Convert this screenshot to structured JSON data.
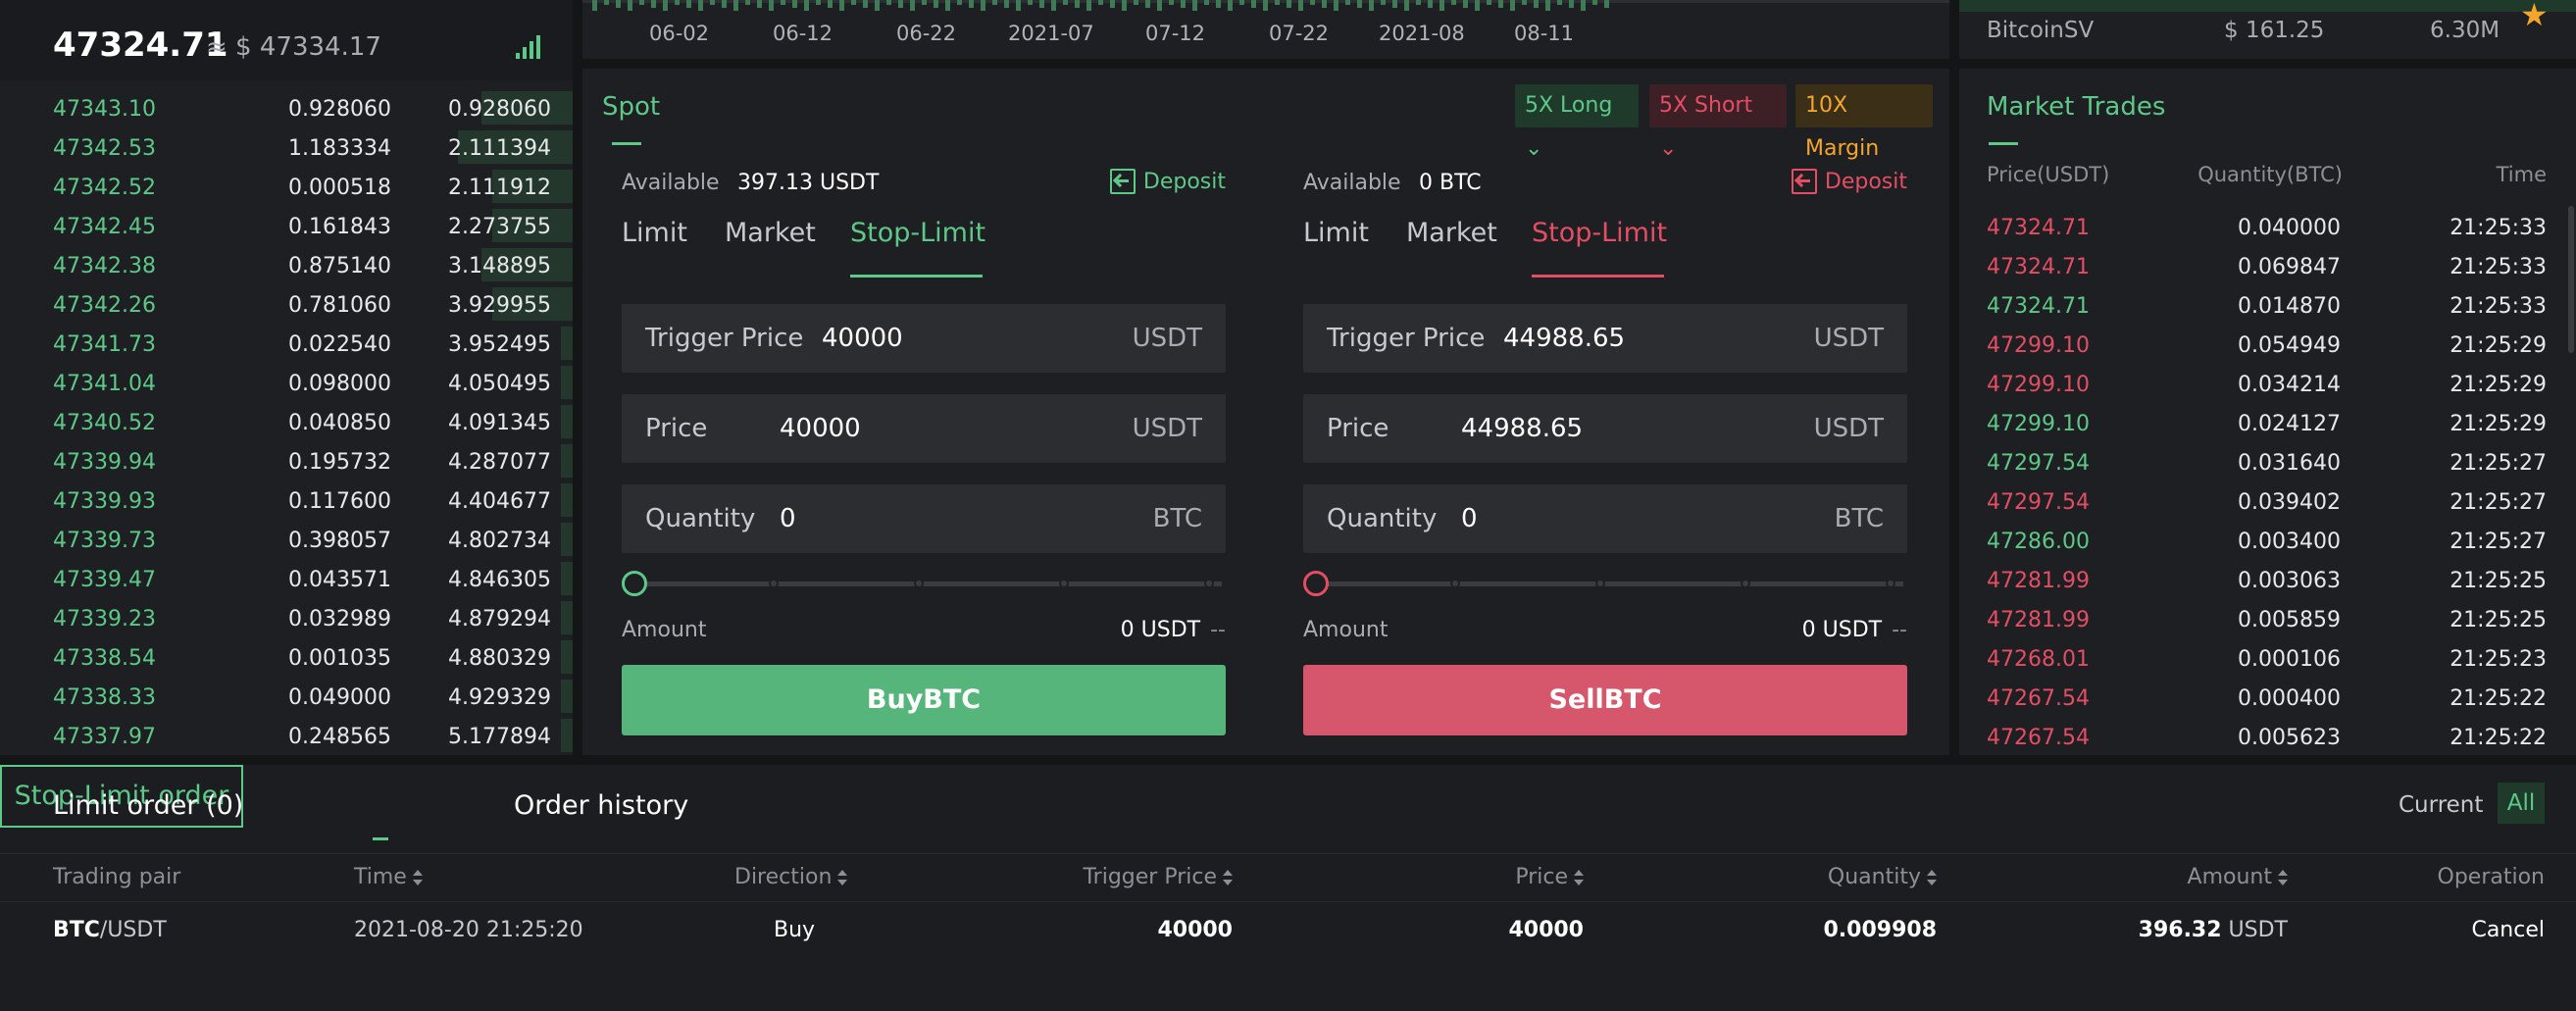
{
  "orderbook": {
    "last_price": "47324.71",
    "approx_label": "≈ $ 47334.17",
    "rows": [
      {
        "price": "47343.10",
        "qty": "0.928060",
        "total": "0.928060",
        "depth": 0.16
      },
      {
        "price": "47342.53",
        "qty": "1.183334",
        "total": "2.111394",
        "depth": 0.2
      },
      {
        "price": "47342.52",
        "qty": "0.000518",
        "total": "2.111912",
        "depth": 0.14
      },
      {
        "price": "47342.45",
        "qty": "0.161843",
        "total": "2.273755",
        "depth": 0.14
      },
      {
        "price": "47342.38",
        "qty": "0.875140",
        "total": "3.148895",
        "depth": 0.16
      },
      {
        "price": "47342.26",
        "qty": "0.781060",
        "total": "3.929955",
        "depth": 0.14
      },
      {
        "price": "47341.73",
        "qty": "0.022540",
        "total": "3.952495",
        "depth": 0.02
      },
      {
        "price": "47341.04",
        "qty": "0.098000",
        "total": "4.050495",
        "depth": 0.02
      },
      {
        "price": "47340.52",
        "qty": "0.040850",
        "total": "4.091345",
        "depth": 0.02
      },
      {
        "price": "47339.94",
        "qty": "0.195732",
        "total": "4.287077",
        "depth": 0.02
      },
      {
        "price": "47339.93",
        "qty": "0.117600",
        "total": "4.404677",
        "depth": 0.02
      },
      {
        "price": "47339.73",
        "qty": "0.398057",
        "total": "4.802734",
        "depth": 0.02
      },
      {
        "price": "47339.47",
        "qty": "0.043571",
        "total": "4.846305",
        "depth": 0.02
      },
      {
        "price": "47339.23",
        "qty": "0.032989",
        "total": "4.879294",
        "depth": 0.02
      },
      {
        "price": "47338.54",
        "qty": "0.001035",
        "total": "4.880329",
        "depth": 0.02
      },
      {
        "price": "47338.33",
        "qty": "0.049000",
        "total": "4.929329",
        "depth": 0.02
      },
      {
        "price": "47337.97",
        "qty": "0.248565",
        "total": "5.177894",
        "depth": 0.02
      }
    ]
  },
  "chart": {
    "ticks": [
      "06-02",
      "06-12",
      "06-22",
      "2021-07",
      "07-12",
      "07-22",
      "2021-08",
      "08-11"
    ]
  },
  "spot": {
    "title": "Spot",
    "tags": {
      "long": "5X Long",
      "short": "5X Short",
      "margin": "10X Margin"
    },
    "buy": {
      "available_label": "Available",
      "available_value": "397.13 USDT",
      "deposit": "Deposit",
      "tabs": [
        "Limit",
        "Market",
        "Stop-Limit"
      ],
      "trigger_label": "Trigger Price",
      "trigger_value": "40000",
      "trigger_unit": "USDT",
      "price_label": "Price",
      "price_value": "40000",
      "price_unit": "USDT",
      "qty_label": "Quantity",
      "qty_value": "0",
      "qty_unit": "BTC",
      "amount_label": "Amount",
      "amount_value": "0 USDT",
      "amount_dash": "--",
      "button": "BuyBTC"
    },
    "sell": {
      "available_label": "Available",
      "available_value": "0 BTC",
      "deposit": "Deposit",
      "tabs": [
        "Limit",
        "Market",
        "Stop-Limit"
      ],
      "trigger_label": "Trigger Price",
      "trigger_value": "44988.65",
      "trigger_unit": "USDT",
      "price_label": "Price",
      "price_value": "44988.65",
      "price_unit": "USDT",
      "qty_label": "Quantity",
      "qty_value": "0",
      "qty_unit": "BTC",
      "amount_label": "Amount",
      "amount_value": "0 USDT",
      "amount_dash": "--",
      "button": "SellBTC"
    }
  },
  "market_trades": {
    "ticker": {
      "name": "BitcoinSV",
      "price": "$ 161.25",
      "volume": "6.30M"
    },
    "title": "Market Trades",
    "headers": {
      "price": "Price(USDT)",
      "qty": "Quantity(BTC)",
      "time": "Time"
    },
    "rows": [
      {
        "price": "47324.71",
        "qty": "0.040000",
        "time": "21:25:33",
        "side": "sell"
      },
      {
        "price": "47324.71",
        "qty": "0.069847",
        "time": "21:25:33",
        "side": "sell"
      },
      {
        "price": "47324.71",
        "qty": "0.014870",
        "time": "21:25:33",
        "side": "buy"
      },
      {
        "price": "47299.10",
        "qty": "0.054949",
        "time": "21:25:29",
        "side": "sell"
      },
      {
        "price": "47299.10",
        "qty": "0.034214",
        "time": "21:25:29",
        "side": "sell"
      },
      {
        "price": "47299.10",
        "qty": "0.024127",
        "time": "21:25:29",
        "side": "buy"
      },
      {
        "price": "47297.54",
        "qty": "0.031640",
        "time": "21:25:27",
        "side": "buy"
      },
      {
        "price": "47297.54",
        "qty": "0.039402",
        "time": "21:25:27",
        "side": "sell"
      },
      {
        "price": "47286.00",
        "qty": "0.003400",
        "time": "21:25:27",
        "side": "buy"
      },
      {
        "price": "47281.99",
        "qty": "0.003063",
        "time": "21:25:25",
        "side": "sell"
      },
      {
        "price": "47281.99",
        "qty": "0.005859",
        "time": "21:25:25",
        "side": "sell"
      },
      {
        "price": "47268.01",
        "qty": "0.000106",
        "time": "21:25:23",
        "side": "sell"
      },
      {
        "price": "47267.54",
        "qty": "0.000400",
        "time": "21:25:22",
        "side": "sell"
      },
      {
        "price": "47267.54",
        "qty": "0.005623",
        "time": "21:25:22",
        "side": "sell"
      }
    ]
  },
  "orders": {
    "tabs": {
      "limit": "Limit order (0)",
      "stop": "Stop-Limit order",
      "history": "Order history"
    },
    "filter": {
      "current": "Current",
      "all": "All"
    },
    "columns": {
      "pair": "Trading pair",
      "time": "Time",
      "direction": "Direction",
      "trigger": "Trigger Price",
      "price": "Price",
      "qty": "Quantity",
      "amount": "Amount",
      "operation": "Operation"
    },
    "rows": [
      {
        "base": "BTC",
        "quote": "/USDT",
        "time": "2021-08-20 21:25:20",
        "direction": "Buy",
        "trigger": "40000",
        "price": "40000",
        "qty": "0.009908",
        "amount": "396.32",
        "amount_unit": "USDT",
        "operation": "Cancel"
      }
    ]
  },
  "colors": {
    "green": "#5dc887",
    "red": "#e34e64",
    "orange": "#f4a52b",
    "bg": "#141517",
    "panel": "#1e1f22"
  }
}
